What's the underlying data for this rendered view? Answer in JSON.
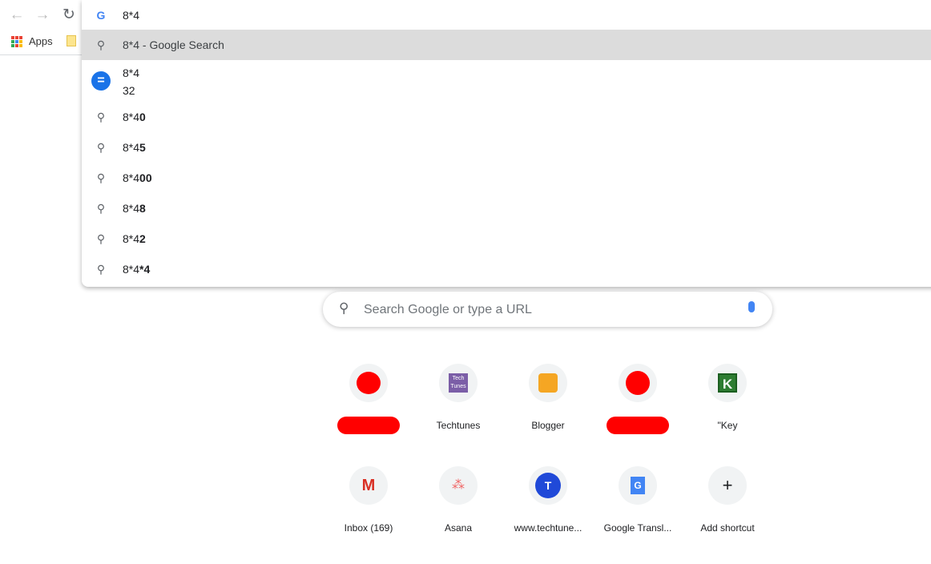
{
  "omnibox": {
    "value": "8*4"
  },
  "suggestions": [
    {
      "type": "search",
      "typed": "8*4 - Google Search",
      "bold": "",
      "selected": true
    },
    {
      "type": "calc",
      "query": "8*4",
      "answer": "32"
    },
    {
      "type": "search",
      "typed": "8*4",
      "bold": "0"
    },
    {
      "type": "search",
      "typed": "8*4",
      "bold": "5"
    },
    {
      "type": "search",
      "typed": "8*4",
      "bold": "00"
    },
    {
      "type": "search",
      "typed": "8*4",
      "bold": "8"
    },
    {
      "type": "search",
      "typed": "8*4",
      "bold": "2"
    },
    {
      "type": "search",
      "typed": "8*4",
      "bold": "*4"
    }
  ],
  "bookmarks": {
    "apps": "Apps"
  },
  "ntp": {
    "search_placeholder": "Search Google or type a URL"
  },
  "shortcuts": [
    {
      "label": ""
    },
    {
      "label": "Techtunes"
    },
    {
      "label": "Blogger"
    },
    {
      "label": ""
    },
    {
      "label": "\"Key"
    },
    {
      "label": "Inbox (169)"
    },
    {
      "label": "Asana"
    },
    {
      "label": "www.techtune..."
    },
    {
      "label": "Google Transl..."
    },
    {
      "label": "Add shortcut"
    }
  ],
  "icons": {
    "techtunes": "Tech Tunes",
    "avatar_t": "T",
    "key": "K",
    "translate": "G",
    "add": "+"
  }
}
